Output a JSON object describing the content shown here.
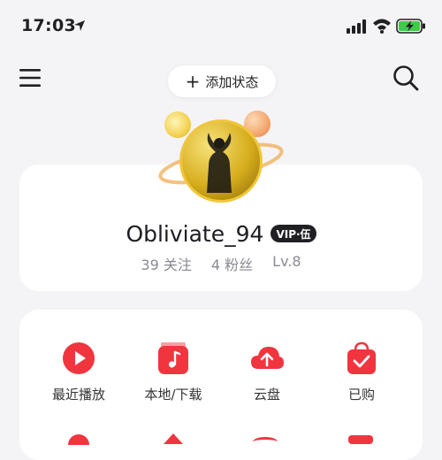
{
  "status_bar": {
    "time": "17:03",
    "icons": [
      "location-arrow-icon",
      "signal-icon",
      "wifi-icon",
      "battery-charging-icon"
    ]
  },
  "header": {
    "status_pill_label": "添加状态",
    "icons": [
      "menu-icon",
      "plus-icon",
      "search-icon"
    ]
  },
  "profile": {
    "username": "Obliviate_94",
    "vip_badge": "VIP·伍",
    "stats": {
      "following": "39 关注",
      "followers": "4 粉丝",
      "level": "Lv.8"
    }
  },
  "menu": {
    "items": [
      {
        "label": "最近播放",
        "icon": "play-circle-icon"
      },
      {
        "label": "本地/下载",
        "icon": "music-folder-icon"
      },
      {
        "label": "云盘",
        "icon": "cloud-upload-icon"
      },
      {
        "label": "已购",
        "icon": "shopping-bag-check-icon"
      }
    ]
  },
  "colors": {
    "accent": "#f0353f",
    "background": "#f4f4f6",
    "card": "#ffffff",
    "muted_text": "#8a8a92",
    "avatar_gold": "#f1c63c"
  }
}
